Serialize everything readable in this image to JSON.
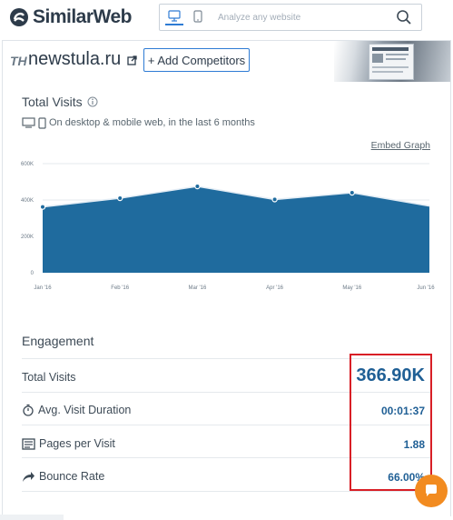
{
  "brand": {
    "name": "SimilarWeb"
  },
  "search": {
    "placeholder": "Analyze any website"
  },
  "site": {
    "name": "newstula.ru",
    "add_competitors_label": "+ Add Competitors"
  },
  "total_visits_section": {
    "title": "Total Visits",
    "subtitle": "On desktop & mobile web, in the last 6 months",
    "embed_label": "Embed Graph"
  },
  "chart_data": {
    "type": "area",
    "title": "",
    "y_ticks": [
      "0",
      "200K",
      "400K",
      "600K"
    ],
    "x_ticks": [
      "Jan '16",
      "Feb '16",
      "Mar '16",
      "Apr '16",
      "May '16",
      "Jun '16"
    ],
    "ylim": [
      0,
      600000
    ],
    "x": [
      "Jan '16",
      "Feb '16",
      "Mar '16",
      "Apr '16",
      "May '16",
      "Jun '16"
    ],
    "values": [
      362000,
      410000,
      475000,
      403000,
      440000,
      367000
    ],
    "color": "#1f6b9e",
    "grid": true
  },
  "engagement": {
    "title": "Engagement",
    "metrics": [
      {
        "label": "Total Visits",
        "value": "366.90K"
      },
      {
        "label": "Avg. Visit Duration",
        "value": "00:01:37"
      },
      {
        "label": "Pages per Visit",
        "value": "1.88"
      },
      {
        "label": "Bounce Rate",
        "value": "66.00%"
      }
    ]
  },
  "colors": {
    "accent": "#2e7bd4",
    "value": "#1f5f95",
    "highlight": "#d81f26",
    "chat": "#f28b20"
  }
}
